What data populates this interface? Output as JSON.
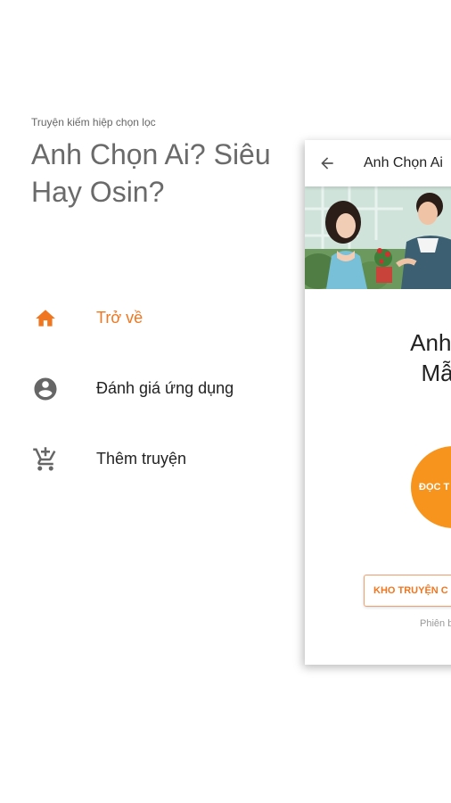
{
  "drawer": {
    "subtitle": "Truyện kiếm hiệp chọn lọc",
    "title": "Anh Chọn Ai? Siêu Mẫu Hay Osin?",
    "title_line1": "Anh Chọn Ai? Siêu",
    "title_line2": "Hay Osin?",
    "items": [
      {
        "label": "Trở về",
        "icon": "home-icon",
        "active": true
      },
      {
        "label": "Đánh giá ứng dụng",
        "icon": "account-circle-icon",
        "active": false
      },
      {
        "label": "Thêm truyện",
        "icon": "add-shopping-cart-icon",
        "active": false
      }
    ]
  },
  "preview": {
    "appbar_title": "Anh Chọn Ai",
    "book_title_line1": "Anh Chọn",
    "book_title_line2": "Mẫu Ha",
    "read_button": "ĐỌC T",
    "store_button": "KHO TRUYỆN C",
    "version": "Phiên b"
  },
  "colors": {
    "accent": "#f0761f",
    "read_button": "#f7941d",
    "icon_gray": "#666666"
  }
}
